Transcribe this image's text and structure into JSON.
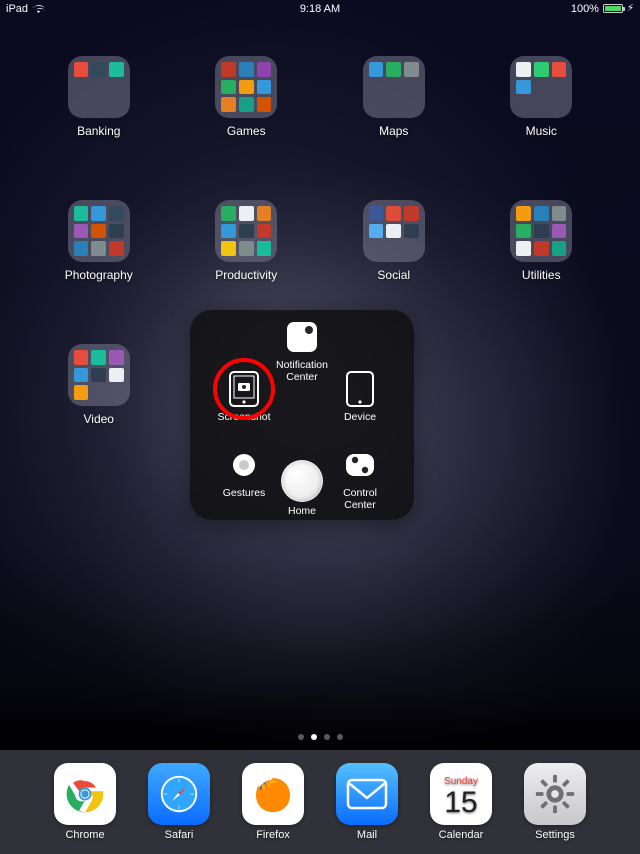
{
  "status": {
    "device": "iPad",
    "time": "9:18 AM",
    "battery_pct": "100%"
  },
  "folders": [
    {
      "label": "Banking",
      "minis": [
        "#e74c3c",
        "#34495e",
        "#1abc9c",
        "",
        "",
        "",
        "",
        "",
        ""
      ]
    },
    {
      "label": "Games",
      "minis": [
        "#c0392b",
        "#2980b9",
        "#8e44ad",
        "#27ae60",
        "#f39c12",
        "#3498db",
        "#e67e22",
        "#16a085",
        "#d35400"
      ]
    },
    {
      "label": "Maps",
      "minis": [
        "#3498db",
        "#27ae60",
        "#7f8c8d",
        "",
        "",
        "",
        "",
        "",
        ""
      ]
    },
    {
      "label": "Music",
      "minis": [
        "#ecf0f1",
        "#2ecc71",
        "#e74c3c",
        "#3498db",
        "",
        "",
        "",
        "",
        ""
      ]
    },
    {
      "label": "Photography",
      "minis": [
        "#1abc9c",
        "#3498db",
        "#34495e",
        "#9b59b6",
        "#d35400",
        "#2c3e50",
        "#2980b9",
        "#7f8c8d",
        "#c0392b"
      ]
    },
    {
      "label": "Productivity",
      "minis": [
        "#27ae60",
        "#ecf0f1",
        "#e67e22",
        "#3498db",
        "#2c3e50",
        "#c0392b",
        "#f1c40f",
        "#7f8c8d",
        "#1abc9c"
      ]
    },
    {
      "label": "Social",
      "minis": [
        "#3b5998",
        "#dd4b39",
        "#c0392b",
        "#55acee",
        "#ecf0f1",
        "#2c3e50",
        "",
        "",
        ""
      ]
    },
    {
      "label": "Utilities",
      "minis": [
        "#f39c12",
        "#2980b9",
        "#7f8c8d",
        "#27ae60",
        "#2c3e50",
        "#9b59b6",
        "#ecf0f1",
        "#c0392b",
        "#16a085"
      ]
    },
    {
      "label": "Video",
      "minis": [
        "#e74c3c",
        "#1abc9c",
        "#9b59b6",
        "#3498db",
        "#2c3e50",
        "#ecf0f1",
        "#f39c12",
        "",
        ""
      ]
    }
  ],
  "assistive_touch": {
    "notification": "Notification\nCenter",
    "screenshot": "Screenshot",
    "device": "Device",
    "gestures": "Gestures",
    "home": "Home",
    "control": "Control\nCenter"
  },
  "pages": {
    "count": 4,
    "active_index": 1
  },
  "dock": {
    "chrome": "Chrome",
    "safari": "Safari",
    "firefox": "Firefox",
    "mail": "Mail",
    "calendar": "Calendar",
    "settings": "Settings",
    "calendar_dow": "Sunday",
    "calendar_day": "15"
  }
}
